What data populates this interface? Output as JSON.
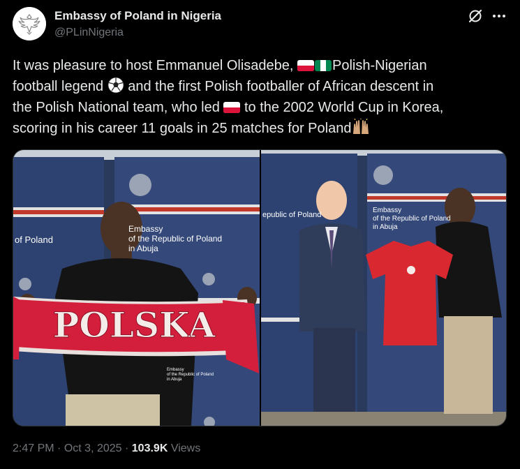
{
  "author": {
    "display_name": "Embassy of Poland in Nigeria",
    "handle": "@PLinNigeria"
  },
  "tweet": {
    "line1_a": "It was pleasure to host Emmanuel Olisadebe, ",
    "line1_b": "Polish-Nigerian",
    "line2_a": "football legend ",
    "line2_b": " and the first Polish footballer of African descent in",
    "line3_a": "the Polish National team, who led ",
    "line3_b": " to the 2002 World Cup in Korea,",
    "line4": "scoring in his career 11 goals in 25 matches for Poland"
  },
  "photo_left": {
    "banner_title_1": "Embassy",
    "banner_title_2": "of the Republic of Poland",
    "banner_title_3": "in Abuja",
    "side_text": "of Poland",
    "scarf_text": "POLSKA",
    "small_banner_1": "Embassy",
    "small_banner_2": "of the Republic of Poland",
    "small_banner_3": "in Abuja"
  },
  "photo_right": {
    "left_banner_text": "epublic of Poland",
    "banner_title_1": "Embassy",
    "banner_title_2": "of the Republic of Poland",
    "banner_title_3": "in Abuja"
  },
  "footer": {
    "time": "2:47 PM",
    "separator": "·",
    "date": "Oct 3, 2025",
    "views_count": "103.9K",
    "views_label": "Views"
  },
  "colors": {
    "background": "#000000",
    "text": "#e7e9ea",
    "muted": "#71767b",
    "poland_red": "#dc143c",
    "nigeria_green": "#008751"
  },
  "icons": [
    "poland-crest-icon",
    "grok-icon",
    "more-icon",
    "poland-flag-icon",
    "nigeria-flag-icon",
    "soccer-ball-icon",
    "raising-hands-icon"
  ]
}
